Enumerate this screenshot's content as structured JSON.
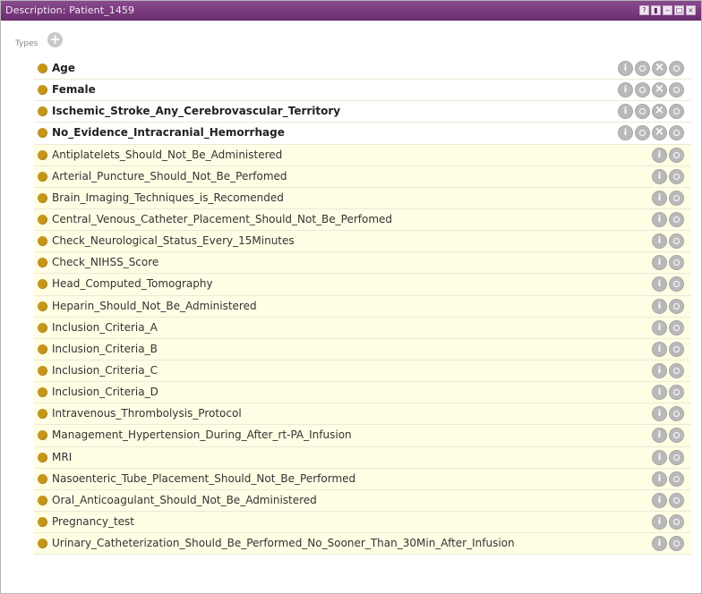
{
  "window": {
    "title": "Description: Patient_1459",
    "buttons": [
      "?",
      "▮",
      "‒",
      "□",
      "×"
    ]
  },
  "types_section": {
    "label": "Types"
  },
  "types": [
    {
      "label": "Age",
      "kind": "asserted"
    },
    {
      "label": "Female",
      "kind": "asserted"
    },
    {
      "label": "Ischemic_Stroke_Any_Cerebrovascular_Territory",
      "kind": "asserted"
    },
    {
      "label": "No_Evidence_Intracranial_Hemorrhage",
      "kind": "asserted"
    },
    {
      "label": "Antiplatelets_Should_Not_Be_Administered",
      "kind": "inferred"
    },
    {
      "label": "Arterial_Puncture_Should_Not_Be_Perfomed",
      "kind": "inferred"
    },
    {
      "label": "Brain_Imaging_Techniques_is_Recomended",
      "kind": "inferred"
    },
    {
      "label": "Central_Venous_Catheter_Placement_Should_Not_Be_Perfomed",
      "kind": "inferred"
    },
    {
      "label": "Check_Neurological_Status_Every_15Minutes",
      "kind": "inferred"
    },
    {
      "label": "Check_NIHSS_Score",
      "kind": "inferred"
    },
    {
      "label": "Head_Computed_Tomography",
      "kind": "inferred"
    },
    {
      "label": "Heparin_Should_Not_Be_Administered",
      "kind": "inferred"
    },
    {
      "label": "Inclusion_Criteria_A",
      "kind": "inferred"
    },
    {
      "label": "Inclusion_Criteria_B",
      "kind": "inferred"
    },
    {
      "label": "Inclusion_Criteria_C",
      "kind": "inferred"
    },
    {
      "label": "Inclusion_Criteria_D",
      "kind": "inferred"
    },
    {
      "label": "Intravenous_Thrombolysis_Protocol",
      "kind": "inferred"
    },
    {
      "label": "Management_Hypertension_During_After_rt-PA_Infusion",
      "kind": "inferred"
    },
    {
      "label": "MRI",
      "kind": "inferred"
    },
    {
      "label": "Nasoenteric_Tube_Placement_Should_Not_Be_Performed",
      "kind": "inferred"
    },
    {
      "label": "Oral_Anticoagulant_Should_Not_Be_Administered",
      "kind": "inferred"
    },
    {
      "label": "Pregnancy_test",
      "kind": "inferred"
    },
    {
      "label": "Urinary_Catheterization_Should_Be_Performed_No_Sooner_Than_30Min_After_Infusion",
      "kind": "inferred"
    }
  ],
  "colors": {
    "titlebar": "#6b2f70",
    "class_dot": "#c4961b",
    "inferred_row_bg": "#fffde4",
    "action_button": "#b9b9b9"
  },
  "icons": {
    "class": "class-circle-icon",
    "add": "plus-icon",
    "info": "info-icon",
    "edit": "edit-icon",
    "delete": "delete-icon",
    "explain": "explain-icon"
  }
}
